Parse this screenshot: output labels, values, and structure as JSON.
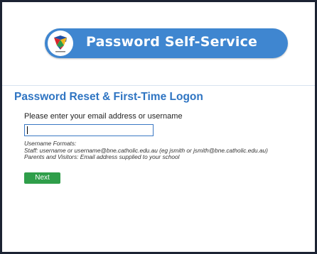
{
  "banner": {
    "title": "Password Self-Service",
    "logo_icon": "school-crest-icon"
  },
  "main": {
    "heading": "Password Reset & First-Time Logon",
    "prompt": "Please enter your email address or username",
    "input_value": "",
    "formats": {
      "title": "Username Formats:",
      "staff": "Staff: username or username@bne.catholic.edu.au (eg jsmith or jsmith@bne.catholic.edu.au)",
      "parents": "Parents and Visitors: Email address supplied to your school"
    },
    "next_label": "Next"
  },
  "colors": {
    "banner": "#3f86d0",
    "heading": "#2e74c2",
    "button": "#2f9e4a"
  }
}
